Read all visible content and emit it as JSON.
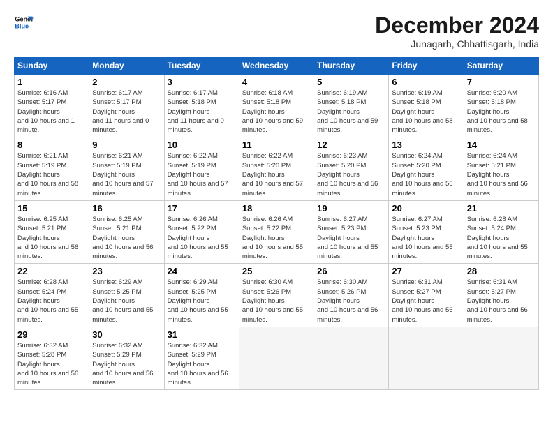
{
  "logo": {
    "line1": "General",
    "line2": "Blue"
  },
  "title": "December 2024",
  "location": "Junagarh, Chhattisgarh, India",
  "weekdays": [
    "Sunday",
    "Monday",
    "Tuesday",
    "Wednesday",
    "Thursday",
    "Friday",
    "Saturday"
  ],
  "weeks": [
    [
      {
        "day": "1",
        "sunrise": "6:16 AM",
        "sunset": "5:17 PM",
        "daylight": "10 hours and 1 minute."
      },
      {
        "day": "2",
        "sunrise": "6:17 AM",
        "sunset": "5:17 PM",
        "daylight": "11 hours and 0 minutes."
      },
      {
        "day": "3",
        "sunrise": "6:17 AM",
        "sunset": "5:18 PM",
        "daylight": "11 hours and 0 minutes."
      },
      {
        "day": "4",
        "sunrise": "6:18 AM",
        "sunset": "5:18 PM",
        "daylight": "10 hours and 59 minutes."
      },
      {
        "day": "5",
        "sunrise": "6:19 AM",
        "sunset": "5:18 PM",
        "daylight": "10 hours and 59 minutes."
      },
      {
        "day": "6",
        "sunrise": "6:19 AM",
        "sunset": "5:18 PM",
        "daylight": "10 hours and 58 minutes."
      },
      {
        "day": "7",
        "sunrise": "6:20 AM",
        "sunset": "5:18 PM",
        "daylight": "10 hours and 58 minutes."
      }
    ],
    [
      {
        "day": "8",
        "sunrise": "6:21 AM",
        "sunset": "5:19 PM",
        "daylight": "10 hours and 58 minutes."
      },
      {
        "day": "9",
        "sunrise": "6:21 AM",
        "sunset": "5:19 PM",
        "daylight": "10 hours and 57 minutes."
      },
      {
        "day": "10",
        "sunrise": "6:22 AM",
        "sunset": "5:19 PM",
        "daylight": "10 hours and 57 minutes."
      },
      {
        "day": "11",
        "sunrise": "6:22 AM",
        "sunset": "5:20 PM",
        "daylight": "10 hours and 57 minutes."
      },
      {
        "day": "12",
        "sunrise": "6:23 AM",
        "sunset": "5:20 PM",
        "daylight": "10 hours and 56 minutes."
      },
      {
        "day": "13",
        "sunrise": "6:24 AM",
        "sunset": "5:20 PM",
        "daylight": "10 hours and 56 minutes."
      },
      {
        "day": "14",
        "sunrise": "6:24 AM",
        "sunset": "5:21 PM",
        "daylight": "10 hours and 56 minutes."
      }
    ],
    [
      {
        "day": "15",
        "sunrise": "6:25 AM",
        "sunset": "5:21 PM",
        "daylight": "10 hours and 56 minutes."
      },
      {
        "day": "16",
        "sunrise": "6:25 AM",
        "sunset": "5:21 PM",
        "daylight": "10 hours and 56 minutes."
      },
      {
        "day": "17",
        "sunrise": "6:26 AM",
        "sunset": "5:22 PM",
        "daylight": "10 hours and 55 minutes."
      },
      {
        "day": "18",
        "sunrise": "6:26 AM",
        "sunset": "5:22 PM",
        "daylight": "10 hours and 55 minutes."
      },
      {
        "day": "19",
        "sunrise": "6:27 AM",
        "sunset": "5:23 PM",
        "daylight": "10 hours and 55 minutes."
      },
      {
        "day": "20",
        "sunrise": "6:27 AM",
        "sunset": "5:23 PM",
        "daylight": "10 hours and 55 minutes."
      },
      {
        "day": "21",
        "sunrise": "6:28 AM",
        "sunset": "5:24 PM",
        "daylight": "10 hours and 55 minutes."
      }
    ],
    [
      {
        "day": "22",
        "sunrise": "6:28 AM",
        "sunset": "5:24 PM",
        "daylight": "10 hours and 55 minutes."
      },
      {
        "day": "23",
        "sunrise": "6:29 AM",
        "sunset": "5:25 PM",
        "daylight": "10 hours and 55 minutes."
      },
      {
        "day": "24",
        "sunrise": "6:29 AM",
        "sunset": "5:25 PM",
        "daylight": "10 hours and 55 minutes."
      },
      {
        "day": "25",
        "sunrise": "6:30 AM",
        "sunset": "5:26 PM",
        "daylight": "10 hours and 55 minutes."
      },
      {
        "day": "26",
        "sunrise": "6:30 AM",
        "sunset": "5:26 PM",
        "daylight": "10 hours and 56 minutes."
      },
      {
        "day": "27",
        "sunrise": "6:31 AM",
        "sunset": "5:27 PM",
        "daylight": "10 hours and 56 minutes."
      },
      {
        "day": "28",
        "sunrise": "6:31 AM",
        "sunset": "5:27 PM",
        "daylight": "10 hours and 56 minutes."
      }
    ],
    [
      {
        "day": "29",
        "sunrise": "6:32 AM",
        "sunset": "5:28 PM",
        "daylight": "10 hours and 56 minutes."
      },
      {
        "day": "30",
        "sunrise": "6:32 AM",
        "sunset": "5:29 PM",
        "daylight": "10 hours and 56 minutes."
      },
      {
        "day": "31",
        "sunrise": "6:32 AM",
        "sunset": "5:29 PM",
        "daylight": "10 hours and 56 minutes."
      },
      null,
      null,
      null,
      null
    ]
  ]
}
